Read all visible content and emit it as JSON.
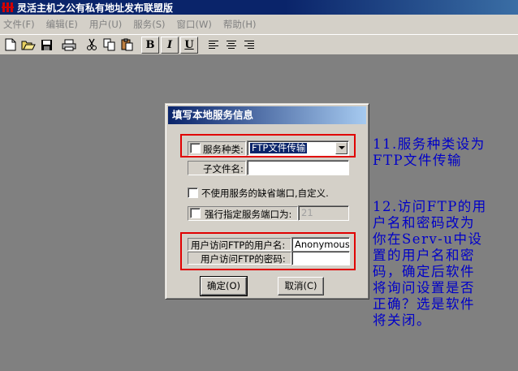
{
  "window": {
    "title": "灵活主机之公有私有地址发布联盟版"
  },
  "menu": [
    "文件(F)",
    "编辑(E)",
    "用户(U)",
    "服务(S)",
    "窗口(W)",
    "帮助(H)"
  ],
  "toolbar": {
    "bold": "B",
    "italic": "I",
    "underline": "U"
  },
  "dialog": {
    "title": "填写本地服务信息",
    "service_type_label": "服务种类:",
    "service_type_value": "FTP文件传输",
    "subfolder_label": "子文件名:",
    "subfolder_value": "",
    "default_port_label": "不使用服务的缺省端口,自定义.",
    "force_port_label": "强行指定服务端口为:",
    "force_port_value": "21",
    "ftp_user_label": "用户访问FTP的用户名:",
    "ftp_user_value": "Anonymous",
    "ftp_pass_label": "用户访问FTP的密码:",
    "ftp_pass_value": "",
    "ok_button": "确定(O)",
    "cancel_button": "取消(C)"
  },
  "annotations": {
    "note1": [
      "11.服务种类设为",
      "FTP文件传输"
    ],
    "note2": [
      "12.访问FTP的用",
      "户名和密码改为",
      "你在Serv-u中设",
      "置的用户名和密",
      "码，确定后软件",
      "将询问设置是否",
      "正确？选是软件",
      "将关闭。"
    ]
  },
  "colors": {
    "titlebar": "#0a246a",
    "highlight_box": "#e00000",
    "note_text": "#0000c8",
    "workspace": "#808080"
  }
}
